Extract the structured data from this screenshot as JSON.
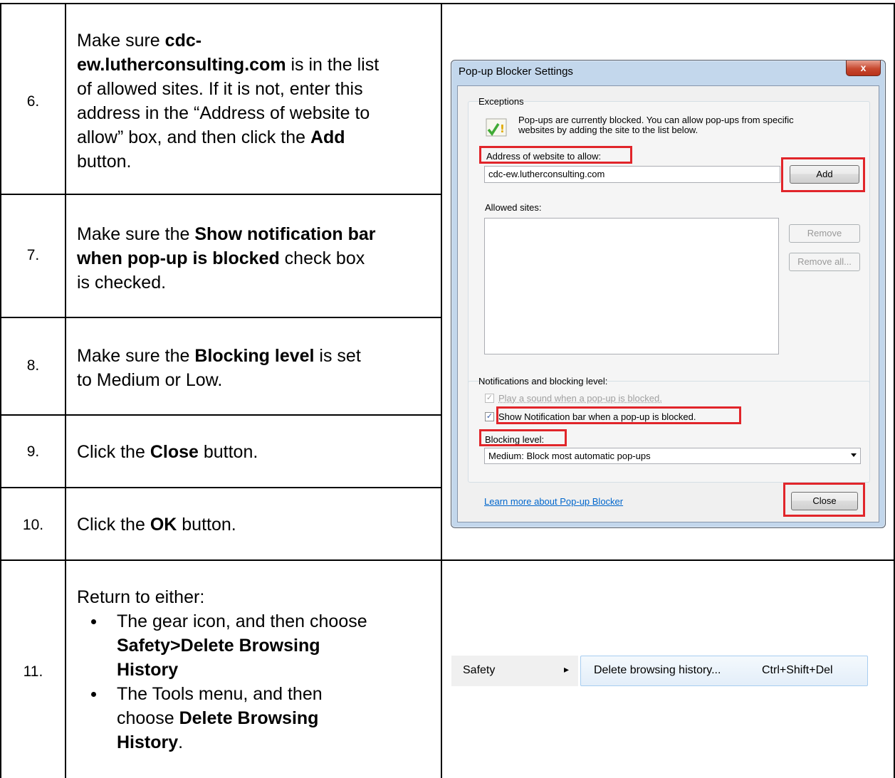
{
  "steps": [
    {
      "num": "6."
    },
    {
      "num": "7."
    },
    {
      "num": "8."
    },
    {
      "num": "9."
    },
    {
      "num": "10."
    },
    {
      "num": "11."
    }
  ],
  "step6": {
    "a": "Make sure ",
    "b": "cdc-",
    "c": "ew.lutherconsulting.com",
    "d": " is in the list",
    "e": "of allowed sites. If it is not, enter this",
    "f": "address in the “Address of website to",
    "g": "allow” box, and then click the ",
    "h": "Add",
    "i": "button."
  },
  "step7": {
    "a": "Make sure the ",
    "b": "Show notification bar",
    "c": "when pop-up is blocked",
    "d": " check box",
    "e": "is checked."
  },
  "step8": {
    "a": "Make sure the ",
    "b": "Blocking level",
    "c": " is set",
    "d": "to Medium or Low."
  },
  "step9": {
    "a": "Click the ",
    "b": "Close",
    "c": " button."
  },
  "step10": {
    "a": "Click the ",
    "b": "OK",
    "c": " button."
  },
  "step11": {
    "intro": "Return to either:",
    "bullet1_a": "The gear icon, and then choose",
    "bullet1_b": "Safety>Delete Browsing",
    "bullet1_c": "History",
    "bullet2_a": "The Tools menu, and then",
    "bullet2_b": "choose ",
    "bullet2_c": "Delete Browsing",
    "bullet2_d": "History",
    "bullet2_e": "."
  },
  "dialog": {
    "title": "Pop-up Blocker Settings",
    "close_glyph": "x",
    "exceptions_label": "Exceptions",
    "info_line1": "Pop-ups are currently blocked.  You can allow pop-ups from specific",
    "info_line2": "websites by adding the site to the list below.",
    "address_label": "Address of website to allow:",
    "address_value": "cdc-ew.lutherconsulting.com",
    "add_button": "Add",
    "allowed_label": "Allowed sites:",
    "remove_button": "Remove",
    "remove_all_button": "Remove all...",
    "notifications_label": "Notifications and blocking level:",
    "play_sound": "Play a sound when a pop-up is blocked.",
    "show_bar": "Show Notification bar when a pop-up is blocked.",
    "blocking_label": "Blocking level:",
    "blocking_value": "Medium: Block most automatic pop-ups",
    "learn_more": "Learn more about Pop-up Blocker",
    "close_button": "Close"
  },
  "menu": {
    "safety": "Safety",
    "arrow": "▸",
    "delete_history": "Delete browsing history...",
    "shortcut": "Ctrl+Shift+Del"
  }
}
